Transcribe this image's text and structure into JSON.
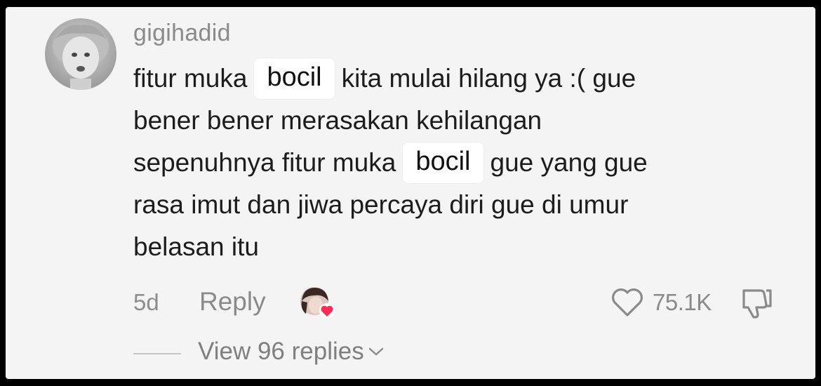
{
  "comment": {
    "username": "gigihadid",
    "lines": [
      {
        "before": "fitur muka",
        "chip": "bocil",
        "after": "kita mulai hilang ya :( gue"
      },
      {
        "text": "bener bener merasakan kehilangan"
      },
      {
        "before": "sepenuhnya fitur muka",
        "chip": "bocil",
        "after": "gue yang gue"
      },
      {
        "text": "rasa imut dan jiwa percaya diri gue di umur"
      },
      {
        "text": "belasan itu"
      }
    ],
    "time": "5d",
    "reply_label": "Reply",
    "like_count": "75.1K",
    "view_replies_label": "View 96 replies"
  },
  "icons": {
    "avatar": "user-avatar-photo",
    "creator": "creator-liked-avatar",
    "heart": "heart-outline-icon",
    "dislike": "thumbs-down-icon",
    "chevron": "chevron-down-icon"
  },
  "colors": {
    "background": "#f4f4f4",
    "text": "#1c1c1c",
    "muted": "#8a8a8a",
    "heart_badge": "#fe2c55"
  }
}
